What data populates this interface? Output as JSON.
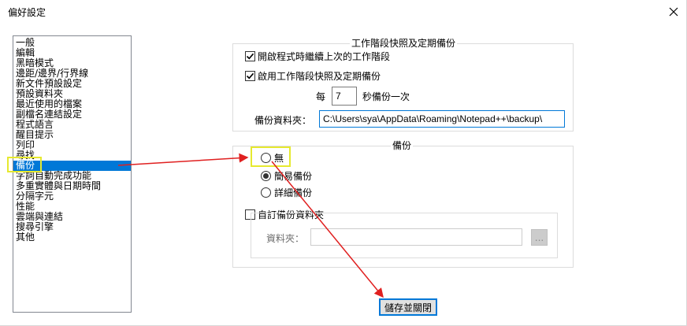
{
  "window": {
    "title": "偏好設定",
    "close_label": "×"
  },
  "categories": [
    "一般",
    "編輯",
    "黑暗模式",
    "邊距/邊界/行界線",
    "新文件預設設定",
    "預設資料夾",
    "最近使用的檔案",
    "副檔名連結設定",
    "程式語言",
    "醒目提示",
    "列印",
    "尋找",
    "備份",
    "字詞自動完成功能",
    "多重實體與日期時間",
    "分隔字元",
    "性能",
    "雲端與連結",
    "搜尋引擎",
    "其他"
  ],
  "selected_category": "備份",
  "snapshot": {
    "title": "工作階段快照及定期備份",
    "remember_session_label": "開啟程式時繼續上次的工作階段",
    "remember_session_checked": true,
    "enable_snapshot_label": "啟用工作階段快照及定期備份",
    "enable_snapshot_checked": true,
    "every_label": "每",
    "interval_value": "7",
    "interval_suffix": "秒備份一次",
    "backup_path_label": "備份資料夾：",
    "backup_path_value": "C:\\Users\\sya\\AppData\\Roaming\\Notepad++\\backup\\"
  },
  "backup": {
    "title": "備份",
    "options": [
      {
        "label": "無",
        "selected": false
      },
      {
        "label": "簡易備份",
        "selected": true
      },
      {
        "label": "詳細備份",
        "selected": false
      }
    ],
    "custom_folder_label": "自訂備份資料夾",
    "custom_folder_checked": false,
    "folder_label": "資料夾：",
    "folder_value": "",
    "browse_label": "..."
  },
  "footer": {
    "save_close_label": "儲存並關閉"
  },
  "colors": {
    "selection": "#0078d7",
    "highlight": "#e6e92f",
    "arrow": "#e02020"
  }
}
